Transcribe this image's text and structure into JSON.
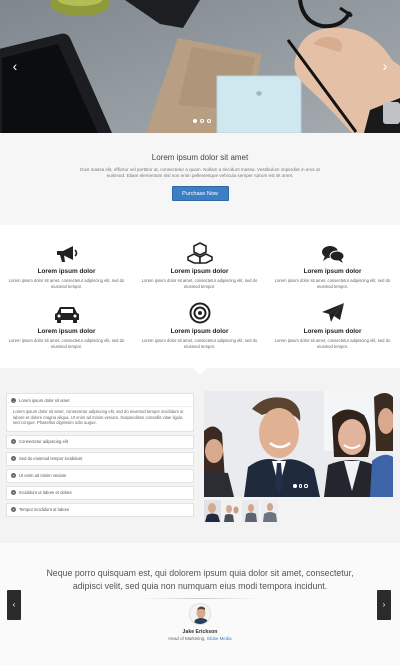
{
  "hero": {
    "prev_icon": "chevron-left-icon",
    "next_icon": "chevron-right-icon",
    "prev_glyph": "‹",
    "next_glyph": "›",
    "slides": 3,
    "active_slide": 1
  },
  "intro": {
    "title": "Lorem ipsum dolor sit amet",
    "text": "Duis massa elit, efficitur vel porttitor at, consectetur a quam. Nullam a tincidunt massa. Vestibulum imperdiet in eros at euismod. Etiam elementum nisl non enim pellentesque vehicula semper rutrum est sit amet.",
    "button_label": "Purchase Now",
    "accent": "#3d7fc4"
  },
  "features": [
    {
      "icon": "megaphone-icon",
      "title": "Lorem ipsum dolor",
      "text": "Lorem ipsum dolor sit amet, consectetur adipiscing elit, sed do eiusmod tempor."
    },
    {
      "icon": "cubes-icon",
      "title": "Lorem ipsum dolor",
      "text": "Lorem ipsum dolor sit amet, consectetur adipiscing elit, sed do eiusmod tempor."
    },
    {
      "icon": "chat-bubbles-icon",
      "title": "Lorem ipsum dolor",
      "text": "Lorem ipsum dolor sit amet, consectetur adipiscing elit, sed do eiusmod tempor."
    },
    {
      "icon": "car-icon",
      "title": "Lorem ipsum dolor",
      "text": "Lorem ipsum dolor sit amet, consectetur adipiscing elit, sed do eiusmod tempor."
    },
    {
      "icon": "target-icon",
      "title": "Lorem ipsum dolor",
      "text": "Lorem ipsum dolor sit amet, consectetur adipiscing elit, sed do eiusmod tempor."
    },
    {
      "icon": "paper-plane-icon",
      "title": "Lorem ipsum dolor",
      "text": "Lorem ipsum dolor sit amet, consectetur adipiscing elit, sed do eiusmod tempor."
    }
  ],
  "accordion": {
    "items": [
      {
        "label": "Lorem ipsum dolor sit amet",
        "expanded": true,
        "body": "Lorem ipsum dolor sit amet, consectetur adipiscing elit, sed do eiusmod tempor incididunt ut labore et dolore magna aliqua. Ut enim ad minim veniam. Suspendisse convallis vitae ligula sed congue. Phasellus dignissim odio augue."
      },
      {
        "label": "Consectetur adipiscing elit",
        "expanded": false
      },
      {
        "label": "Sed do eiusmod tempor incididunt",
        "expanded": false
      },
      {
        "label": "Ut enim ad minim veniam",
        "expanded": false
      },
      {
        "label": "Incididunt ut labore et dolore",
        "expanded": false
      },
      {
        "label": "Tempor incididunt ut labore",
        "expanded": false
      }
    ]
  },
  "gallery": {
    "slides": 3,
    "active_slide": 1,
    "thumbnails": 4
  },
  "testimonial": {
    "quote": "Neque porro quisquam est, qui dolorem ipsum quia dolor sit amet, consectetur, adipisci velit, sed quia non numquam eius modi tempora incidunt.",
    "name": "Jake Erickson",
    "role": "Head of Marketing,",
    "company": "Globe Media",
    "prev_glyph": "‹",
    "next_glyph": "›"
  }
}
